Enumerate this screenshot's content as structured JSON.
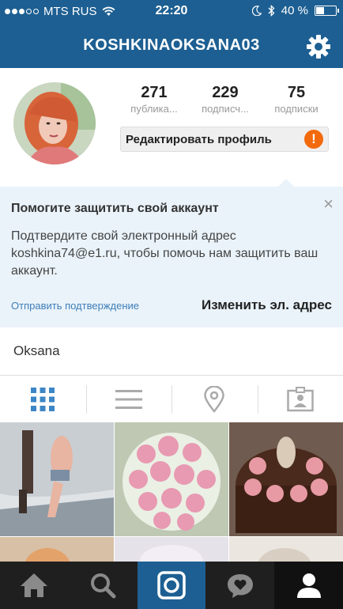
{
  "status_bar": {
    "carrier": "MTS RUS",
    "time": "22:20",
    "battery": "40 %",
    "battery_level": 0.4
  },
  "nav": {
    "title": "KOSHKINAOKSANA03",
    "settings_icon": "gear-icon"
  },
  "profile": {
    "stats": [
      {
        "value": "271",
        "label": "публика..."
      },
      {
        "value": "229",
        "label": "подписч..."
      },
      {
        "value": "75",
        "label": "подписки"
      }
    ],
    "edit_button": "Редактировать профиль",
    "warning_badge": "!",
    "name": "Oksana"
  },
  "banner": {
    "title": "Помогите защитить свой аккаунт",
    "body": "Подтвердите свой электронный адрес koshkina74@e1.ru, чтобы помочь нам защитить ваш аккаунт.",
    "send_link": "Отправить подтверждение",
    "change_link": "Изменить эл. адрес"
  },
  "tabs": [
    "grid-icon",
    "list-icon",
    "location-icon",
    "tagged-icon"
  ],
  "bottom_nav": [
    "home-icon",
    "search-icon",
    "camera-icon",
    "activity-icon",
    "profile-icon"
  ],
  "colors": {
    "header": "#1d5f92",
    "banner_bg": "#eaf3fa",
    "warning": "#f36a0d",
    "link": "#3d7db8"
  }
}
